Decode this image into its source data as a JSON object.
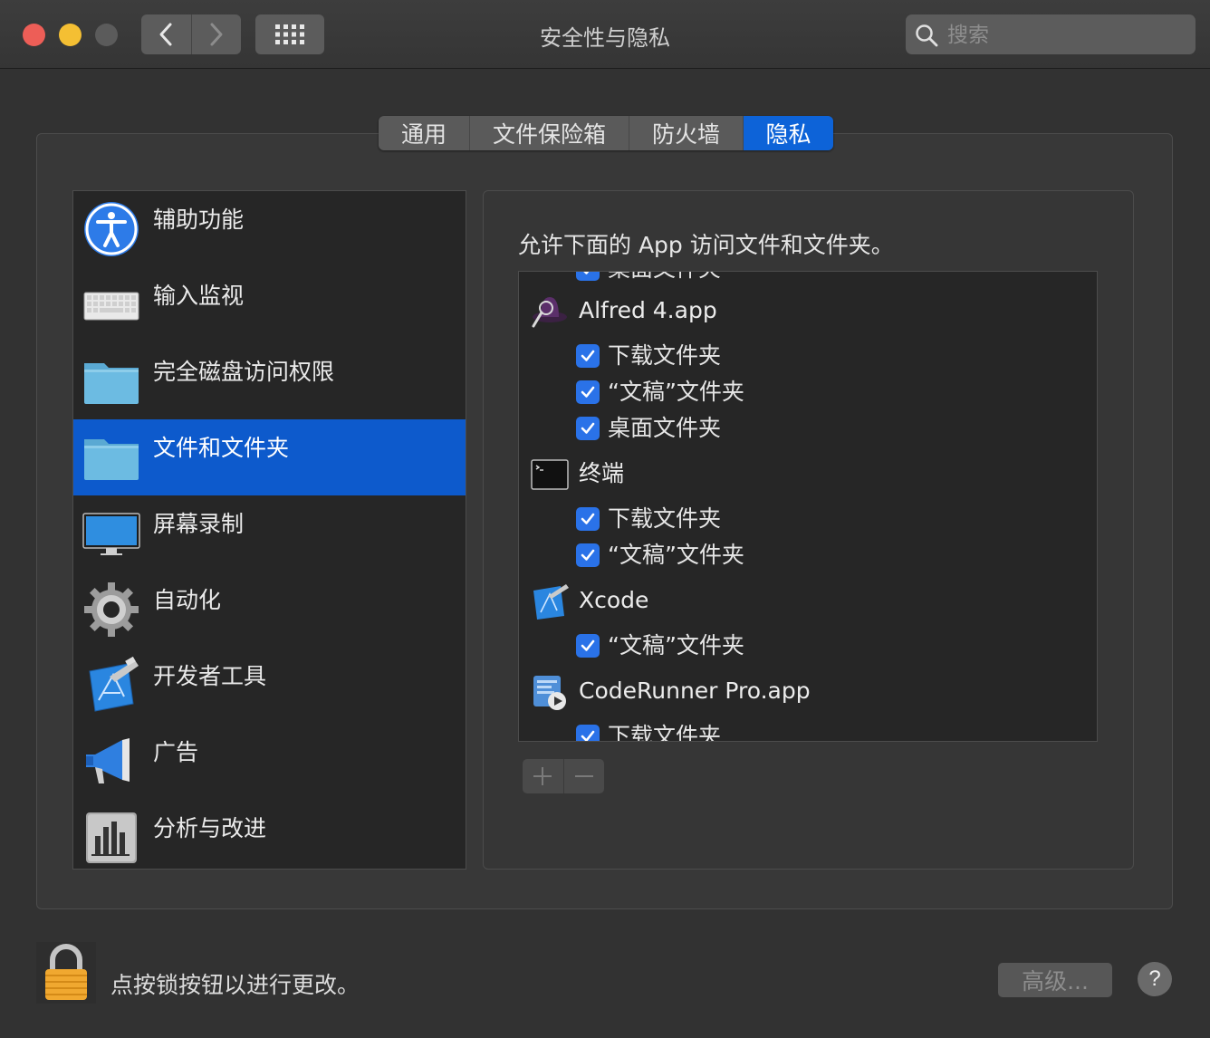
{
  "window": {
    "title": "安全性与隐私"
  },
  "toolbar": {
    "back_icon": "chevron-left-icon",
    "forward_icon": "chevron-right-icon",
    "grid_icon": "grid-icon"
  },
  "search": {
    "placeholder": "搜索"
  },
  "tabs": [
    {
      "label": "通用",
      "active": false
    },
    {
      "label": "文件保险箱",
      "active": false
    },
    {
      "label": "防火墙",
      "active": false
    },
    {
      "label": "隐私",
      "active": true
    }
  ],
  "sidebar": {
    "items": [
      {
        "label": "辅助功能",
        "icon": "accessibility-icon"
      },
      {
        "label": "输入监视",
        "icon": "keyboard-icon"
      },
      {
        "label": "完全磁盘访问权限",
        "icon": "folder-icon"
      },
      {
        "label": "文件和文件夹",
        "icon": "folder-icon",
        "active": true
      },
      {
        "label": "屏幕录制",
        "icon": "display-icon"
      },
      {
        "label": "自动化",
        "icon": "gear-icon"
      },
      {
        "label": "开发者工具",
        "icon": "developer-tools-icon"
      },
      {
        "label": "广告",
        "icon": "megaphone-icon"
      },
      {
        "label": "分析与改进",
        "icon": "bar-chart-icon"
      }
    ]
  },
  "main": {
    "description": "允许下面的 App 访问文件和文件夹。",
    "list": {
      "partial_top": "桌面文件夹",
      "apps": [
        {
          "name": "Alfred 4.app",
          "icon": "alfred-icon",
          "items": [
            {
              "label": "下载文件夹",
              "checked": true
            },
            {
              "label": "“文稿”文件夹",
              "checked": true
            },
            {
              "label": "桌面文件夹",
              "checked": true
            }
          ]
        },
        {
          "name": "终端",
          "icon": "terminal-icon",
          "items": [
            {
              "label": "下载文件夹",
              "checked": true
            },
            {
              "label": "“文稿”文件夹",
              "checked": true
            }
          ]
        },
        {
          "name": "Xcode",
          "icon": "xcode-icon",
          "items": [
            {
              "label": "“文稿”文件夹",
              "checked": true
            }
          ]
        },
        {
          "name": "CodeRunner Pro.app",
          "icon": "coderunner-icon",
          "items": [
            {
              "label": "下载文件夹",
              "checked": true
            }
          ]
        }
      ]
    },
    "add_icon": "plus-icon",
    "remove_icon": "minus-icon"
  },
  "footer": {
    "lock_text": "点按锁按钮以进行更改。",
    "advanced_label": "高级...",
    "help_label": "?"
  }
}
